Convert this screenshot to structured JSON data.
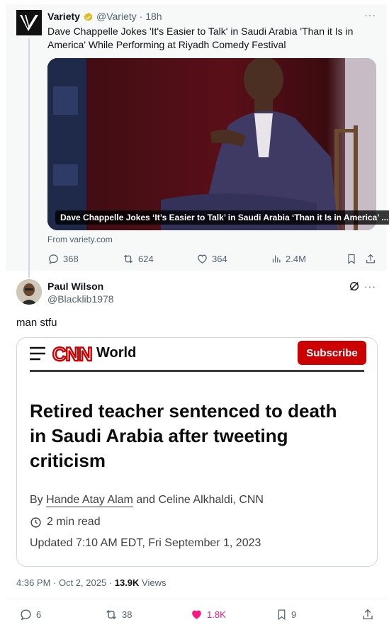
{
  "quoted_tweet": {
    "author_name": "Variety",
    "handle": "@Variety",
    "time": "· 18h",
    "more": "···",
    "text": "Dave Chappelle Jokes 'It's Easier to Talk' in Saudi Arabia 'Than it Is in America' While Performing at Riyadh Comedy Festival",
    "card": {
      "caption": "Dave Chappelle Jokes ‘It’s Easier to Talk’ in Saudi Arabia ‘Than it Is in America’ ...",
      "source": "From variety.com"
    },
    "actions": {
      "replies": "368",
      "reposts": "624",
      "likes": "364",
      "views": "2.4M"
    }
  },
  "reply_tweet": {
    "author_name": "Paul Wilson",
    "handle": "@Blacklib1978",
    "more": "···",
    "text": "man stfu",
    "embedded_article": {
      "brand": "CNN",
      "section": "World",
      "subscribe_label": "Subscribe",
      "headline": "Retired teacher sentenced to death in Saudi Arabia after tweeting criticism",
      "by_prefix": "By",
      "author_1": "Hande Atay Alam",
      "author_rest": "and Celine Alkhaldi, CNN",
      "read_time": "2 min read",
      "updated": "Updated 7:10 AM EDT, Fri September 1, 2023"
    },
    "timestamp": "4:36 PM · Oct 2, 2025 · ",
    "views_count": "13.9K",
    "views_label": " Views",
    "actions": {
      "replies": "6",
      "reposts": "38",
      "likes": "1.8K",
      "bookmarks": "9"
    }
  },
  "colors": {
    "secondary_text": "#536471",
    "like_active": "#f91880",
    "cnn_red": "#cc0000",
    "verified_gold": "#e2b719"
  }
}
